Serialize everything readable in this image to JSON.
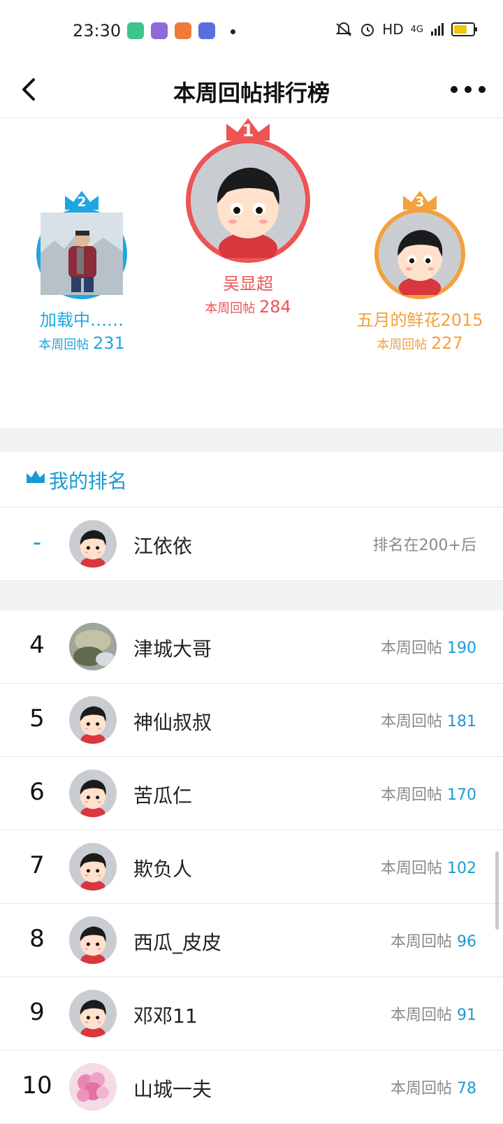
{
  "status_bar": {
    "time": "23:30",
    "network": "HD",
    "signal": "4G"
  },
  "header": {
    "title": "本周回帖排行榜"
  },
  "podium": [
    {
      "rank": "1",
      "name": "吴显超",
      "label": "本周回帖",
      "count": "284",
      "color": "#ee5454"
    },
    {
      "rank": "2",
      "name": "加载中……",
      "label": "本周回帖",
      "count": "231",
      "color": "#1ea6e0"
    },
    {
      "rank": "3",
      "name": "五月的鲜花2015",
      "label": "本周回帖",
      "count": "227",
      "color": "#f3a13c"
    }
  ],
  "my_rank": {
    "heading": "我的排名",
    "rank": "-",
    "name": "江依依",
    "status": "排名在200+后"
  },
  "list": [
    {
      "rank": "4",
      "name": "津城大哥",
      "label": "本周回帖",
      "count": "190",
      "avatar": "photo-avatar"
    },
    {
      "rank": "5",
      "name": "神仙叔叔",
      "label": "本周回帖",
      "count": "181",
      "avatar": "default-avatar"
    },
    {
      "rank": "6",
      "name": "苦瓜仁",
      "label": "本周回帖",
      "count": "170",
      "avatar": "default-avatar"
    },
    {
      "rank": "7",
      "name": "欺负人",
      "label": "本周回帖",
      "count": "102",
      "avatar": "default-avatar"
    },
    {
      "rank": "8",
      "name": "西瓜_皮皮",
      "label": "本周回帖",
      "count": "96",
      "avatar": "default-avatar"
    },
    {
      "rank": "9",
      "name": "邓邓11",
      "label": "本周回帖",
      "count": "91",
      "avatar": "default-avatar"
    },
    {
      "rank": "10",
      "name": "山城一夫",
      "label": "本周回帖",
      "count": "78",
      "avatar": "flower-avatar"
    }
  ],
  "colors": {
    "accent": "#1b9ad2",
    "first": "#ee5454",
    "second": "#1ea6e0",
    "third": "#f3a13c"
  }
}
